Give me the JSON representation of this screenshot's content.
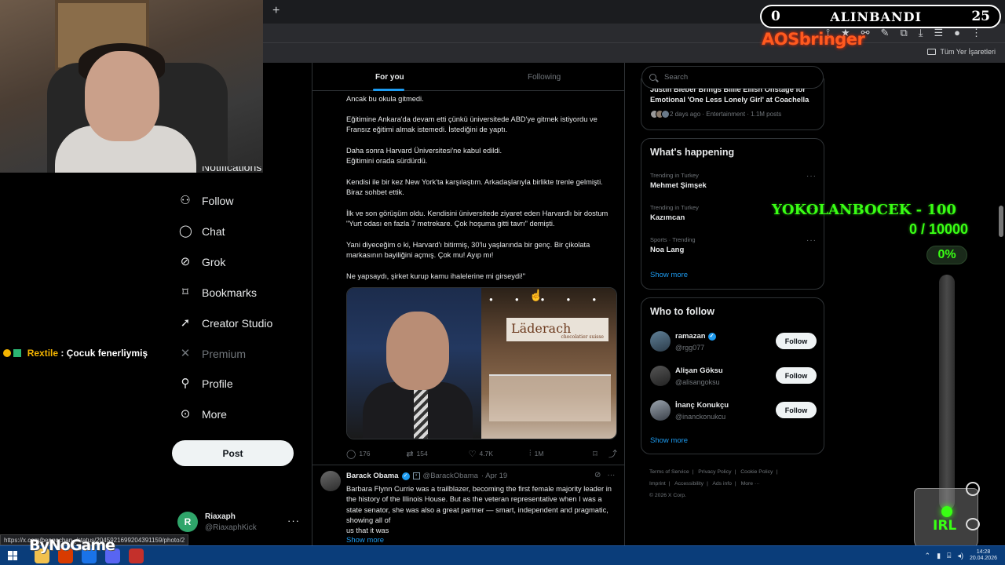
{
  "browser": {
    "new_tab_symbol": "+",
    "all_bookmarks_label": "Tüm Yer İşaretleri",
    "toolbar_icons": [
      "cast-icon",
      "star-icon",
      "link-icon",
      "pen-icon",
      "extensions-icon",
      "download-icon",
      "reading-list-icon",
      "profile-icon",
      "menu-icon"
    ]
  },
  "overlay": {
    "counter_left": "0",
    "counter_label": "ALINBANDI",
    "counter_right": "25",
    "bringer_text": "AOSbringer",
    "chat_user": "Rextile",
    "chat_message": ": Çocuk fenerliymiş",
    "goal_title": "YOKOLANBOCEK - 100",
    "goal_progress": "0 / 10000",
    "goal_percent": "0%",
    "goal_fraction": 0,
    "irl_label": "IRL",
    "bynogame_label": "ByNoGame",
    "status_url": "https://x.com/bengochan_/status/2045921699204391159/photo/2"
  },
  "nav": {
    "cut_item": "Notifications",
    "items": [
      {
        "label": "Follow",
        "icon": "person-plus-icon"
      },
      {
        "label": "Chat",
        "icon": "chat-bubble-icon"
      },
      {
        "label": "Grok",
        "icon": "grok-icon"
      },
      {
        "label": "Bookmarks",
        "icon": "bookmark-icon"
      },
      {
        "label": "Creator Studio",
        "icon": "rocket-icon"
      },
      {
        "label": "Premium",
        "icon": "x-logo-icon"
      },
      {
        "label": "Profile",
        "icon": "person-icon"
      },
      {
        "label": "More",
        "icon": "more-circle-icon"
      }
    ],
    "post_label": "Post",
    "account": {
      "initial": "R",
      "name": "Riaxaph",
      "handle": "@RiaxaphKick"
    }
  },
  "main": {
    "tabs": [
      "For you",
      "Following"
    ],
    "tweet1": {
      "paragraphs": [
        "Ancak bu okula gitmedi.",
        "Eğitimine Ankara'da devam etti çünkü üniversitede ABD'ye gitmek istiyordu ve Fransız eğitimi almak istemedi. İstediğini de yaptı.",
        "Daha sonra Harvard Üniversitesi'ne kabul edildi.\nEğitimini orada sürdürdü.",
        "Kendisi ile bir kez New York'ta karşılaştım. Arkadaşlarıyla birlikte trenle gelmişti. Biraz sohbet ettik.",
        "İlk ve son görüşüm oldu. Kendisini üniversitede ziyaret eden Harvardlı bir dostum \"Yurt odası en fazla 7 metrekare. Çok hoşuma gitti tavrı\" demişti.",
        "Yani diyeceğim o ki, Harvard'ı bitirmiş, 30'lu yaşlarında bir genç. Bir çikolata markasının bayiliğini açmış. Çok mu! Ayıp mı!",
        "Ne yapsaydı, şirket kurup kamu ihalelerine mi girseydi!\""
      ],
      "media_sign": "Läderach",
      "media_sign_sub": "chocolatier suisse",
      "stats": {
        "replies": "176",
        "reposts": "154",
        "likes": "4.7K",
        "views": "1M"
      }
    },
    "tweet2": {
      "name": "Barack Obama",
      "handle": "@BarackObama",
      "date": "· Apr 19",
      "text": "Barbara Flynn Currie was a trailblazer, becoming the first female majority leader in the history of the Illinois House. But as the veteran representative when I was a state senator, she was also a great partner — smart, independent and pragmatic, showing all of\nus that it was",
      "show_more": "Show more"
    }
  },
  "right": {
    "search_placeholder": "Search",
    "news": {
      "title": "Justin Bieber Brings Billie Eilish Onstage for Emotional 'One Less Lonely Girl' at Coachella",
      "meta": "2 days ago · Entertainment · 1.1M posts"
    },
    "happening": {
      "title": "What's happening",
      "trends": [
        {
          "context": "Trending in Turkey",
          "name": "Mehmet Şimşek"
        },
        {
          "context": "Trending in Turkey",
          "name": "Kazımcan"
        },
        {
          "context": "Sports · Trending",
          "name": "Noa Lang"
        }
      ],
      "show_more": "Show more"
    },
    "who_to_follow": {
      "title": "Who to follow",
      "people": [
        {
          "name": "ramazan",
          "handle": "@rgg077",
          "verified": true
        },
        {
          "name": "Alişan Göksu",
          "handle": "@alisangoksu",
          "verified": false
        },
        {
          "name": "İnanç Konukçu",
          "handle": "@inanckonukcu",
          "verified": false
        }
      ],
      "follow_label": "Follow",
      "show_more": "Show more"
    },
    "footer": [
      "Terms of Service",
      "Privacy Policy",
      "Cookie Policy",
      "Imprint",
      "Accessibility",
      "Ads info",
      "More ···",
      "© 2026 X Corp."
    ]
  },
  "taskbar": {
    "time": "14:28",
    "date": "20.04.2026",
    "app_colors": [
      "#f2c14e",
      "#d83b01",
      "#1a73e8",
      "#5865f2",
      "#c4302b"
    ]
  }
}
